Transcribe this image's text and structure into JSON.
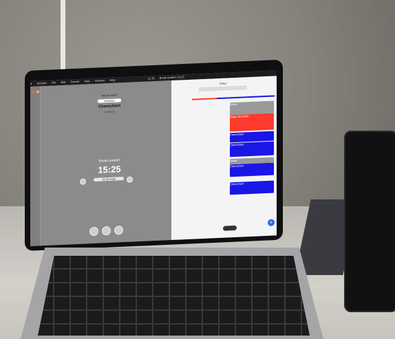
{
  "menubar": {
    "app": "Session",
    "items": [
      "File",
      "Edit",
      "Format",
      "View",
      "Window",
      "Help"
    ],
    "clock": "11:15",
    "status": "Break ended | 15:25"
  },
  "timer": {
    "prompt": "What's next?",
    "tag": "Intention",
    "task": "Chemchem",
    "subtitle": "Intention",
    "status": "Break ended!",
    "time": "15:25",
    "pill": "15:25 ends"
  },
  "calendar": {
    "header": "Today",
    "events": [
      "Break",
      "Study for Exam",
      "Chemchem",
      "Chemchem",
      "Break",
      "Chemchem",
      "Chemchem"
    ]
  },
  "colors": {
    "red_event": "#ff3b2e",
    "blue_event": "#1a16e6",
    "gray_event": "#9a9a9a",
    "accent": "#2f62ff"
  }
}
